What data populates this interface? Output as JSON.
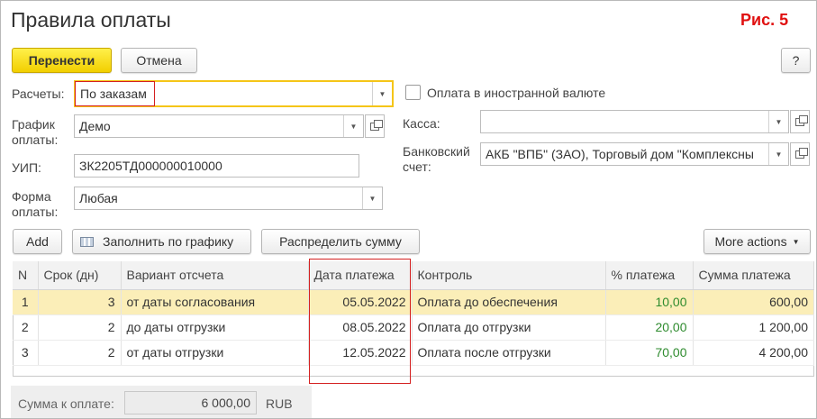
{
  "window": {
    "title": "Правила оплаты",
    "figure_label": "Рис. 5"
  },
  "toolbar": {
    "transfer_label": "Перенести",
    "cancel_label": "Отмена",
    "help_label": "?"
  },
  "form": {
    "raschety_label": "Расчеты:",
    "raschety_value": "По заказам",
    "grafik_label": "График\nоплаты:",
    "grafik_value": "Демо",
    "uip_label": "УИП:",
    "uip_value": "ЗК2205ТД000000010000",
    "forma_label": "Форма\nоплаты:",
    "forma_value": "Любая",
    "foreign_currency_label": "Оплата в иностранной валюте",
    "kassa_label": "Касса:",
    "kassa_value": "",
    "bank_label": "Банковский\nсчет:",
    "bank_value": "АКБ \"ВПБ\" (ЗАО), Торговый дом \"Комплексны"
  },
  "table_toolbar": {
    "add_label": "Add",
    "fill_label": "Заполнить по графику",
    "distribute_label": "Распределить сумму",
    "more_label": "More actions"
  },
  "table": {
    "columns": [
      "N",
      "Срок (дн)",
      "Вариант отсчета",
      "Дата платежа",
      "Контроль",
      "% платежа",
      "Сумма платежа"
    ],
    "rows": [
      {
        "n": "1",
        "days": "3",
        "variant": "от даты согласования",
        "date": "05.05.2022",
        "control": "Оплата до обеспечения",
        "pct": "10,00",
        "sum": "600,00"
      },
      {
        "n": "2",
        "days": "2",
        "variant": "до даты отгрузки",
        "date": "08.05.2022",
        "control": "Оплата до отгрузки",
        "pct": "20,00",
        "sum": "1 200,00"
      },
      {
        "n": "3",
        "days": "2",
        "variant": "от даты отгрузки",
        "date": "12.05.2022",
        "control": "Оплата после отгрузки",
        "pct": "70,00",
        "sum": "4 200,00"
      }
    ]
  },
  "footer": {
    "sum_label": "Сумма к оплате:",
    "sum_value": "6 000,00",
    "currency": "RUB"
  },
  "colors": {
    "accent_yellow": "#f2cf00",
    "selected_row": "#fbeeb8",
    "annotation_red": "#d42020",
    "percent_green": "#2e8b2e"
  },
  "icons": [
    "dropdown-arrow-icon",
    "open-form-icon",
    "fill-schedule-icon"
  ]
}
